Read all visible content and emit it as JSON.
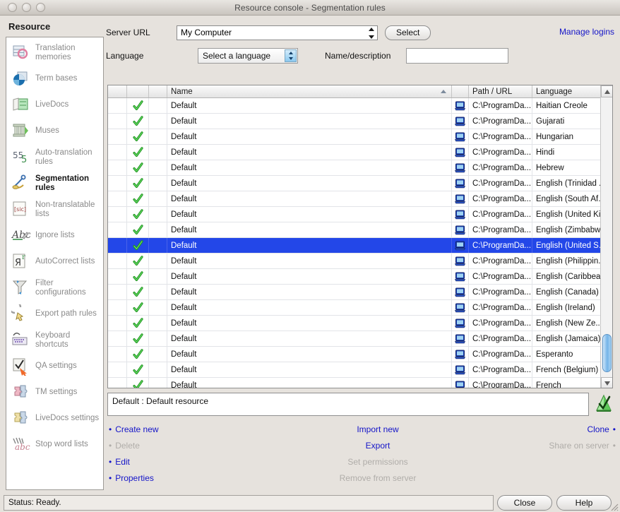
{
  "window": {
    "title": "Resource console - Segmentation rules",
    "traffic_buttons": [
      "close-button",
      "minimize-button",
      "zoom-button"
    ]
  },
  "sidebar": {
    "heading": "Resource",
    "items": [
      {
        "label": "Translation memories",
        "icon": "translation-memories-icon",
        "active": false
      },
      {
        "label": "Term bases",
        "icon": "term-bases-icon",
        "active": false
      },
      {
        "label": "LiveDocs",
        "icon": "livedocs-icon",
        "active": false
      },
      {
        "label": "Muses",
        "icon": "muses-icon",
        "active": false
      },
      {
        "label": "Auto-translation rules",
        "icon": "auto-translation-rules-icon",
        "active": false
      },
      {
        "label": "Segmentation rules",
        "icon": "segmentation-rules-icon",
        "active": true
      },
      {
        "label": "Non-translatable lists",
        "icon": "non-translatable-lists-icon",
        "active": false
      },
      {
        "label": "Ignore lists",
        "icon": "ignore-lists-icon",
        "active": false
      },
      {
        "label": "AutoCorrect lists",
        "icon": "autocorrect-lists-icon",
        "active": false
      },
      {
        "label": "Filter configurations",
        "icon": "filter-configurations-icon",
        "active": false
      },
      {
        "label": "Export path rules",
        "icon": "export-path-rules-icon",
        "active": false
      },
      {
        "label": "Keyboard shortcuts",
        "icon": "keyboard-shortcuts-icon",
        "active": false
      },
      {
        "label": "QA settings",
        "icon": "qa-settings-icon",
        "active": false
      },
      {
        "label": "TM settings",
        "icon": "tm-settings-icon",
        "active": false
      },
      {
        "label": "LiveDocs settings",
        "icon": "livedocs-settings-icon",
        "active": false
      },
      {
        "label": "Stop word lists",
        "icon": "stop-word-lists-icon",
        "active": false
      }
    ]
  },
  "toolbar": {
    "server_url_label": "Server URL",
    "server_url_value": "My Computer",
    "select_button": "Select",
    "manage_logins": "Manage logins",
    "language_label": "Language",
    "language_value": "Select a language",
    "name_description_label": "Name/description",
    "name_description_value": "",
    "name_description_placeholder": ""
  },
  "table": {
    "columns": [
      {
        "key": "selector",
        "label": ""
      },
      {
        "key": "enabled",
        "label": ""
      },
      {
        "key": "lock",
        "label": ""
      },
      {
        "key": "name",
        "label": "Name",
        "sorted": "asc"
      },
      {
        "key": "source_icon",
        "label": ""
      },
      {
        "key": "path",
        "label": "Path / URL"
      },
      {
        "key": "language",
        "label": "Language"
      }
    ],
    "rows": [
      {
        "enabled": true,
        "name": "Default",
        "path": "C:\\ProgramDa...",
        "language": "Haitian Creole",
        "selected": false
      },
      {
        "enabled": true,
        "name": "Default",
        "path": "C:\\ProgramDa...",
        "language": "Gujarati",
        "selected": false
      },
      {
        "enabled": true,
        "name": "Default",
        "path": "C:\\ProgramDa...",
        "language": "Hungarian",
        "selected": false
      },
      {
        "enabled": true,
        "name": "Default",
        "path": "C:\\ProgramDa...",
        "language": "Hindi",
        "selected": false
      },
      {
        "enabled": true,
        "name": "Default",
        "path": "C:\\ProgramDa...",
        "language": "Hebrew",
        "selected": false
      },
      {
        "enabled": true,
        "name": "Default",
        "path": "C:\\ProgramDa...",
        "language": "English (Trinidad ...",
        "selected": false
      },
      {
        "enabled": true,
        "name": "Default",
        "path": "C:\\ProgramDa...",
        "language": "English (South Af...",
        "selected": false
      },
      {
        "enabled": true,
        "name": "Default",
        "path": "C:\\ProgramDa...",
        "language": "English (United Ki...",
        "selected": false
      },
      {
        "enabled": true,
        "name": "Default",
        "path": "C:\\ProgramDa...",
        "language": "English (Zimbabwe)",
        "selected": false
      },
      {
        "enabled": true,
        "name": "Default",
        "path": "C:\\ProgramDa...",
        "language": "English (United S...",
        "selected": true
      },
      {
        "enabled": true,
        "name": "Default",
        "path": "C:\\ProgramDa...",
        "language": "English (Philippin...",
        "selected": false
      },
      {
        "enabled": true,
        "name": "Default",
        "path": "C:\\ProgramDa...",
        "language": "English (Caribbean)",
        "selected": false
      },
      {
        "enabled": true,
        "name": "Default",
        "path": "C:\\ProgramDa...",
        "language": "English (Canada)",
        "selected": false
      },
      {
        "enabled": true,
        "name": "Default",
        "path": "C:\\ProgramDa...",
        "language": "English (Ireland)",
        "selected": false
      },
      {
        "enabled": true,
        "name": "Default",
        "path": "C:\\ProgramDa...",
        "language": "English (New Ze...",
        "selected": false
      },
      {
        "enabled": true,
        "name": "Default",
        "path": "C:\\ProgramDa...",
        "language": "English (Jamaica)",
        "selected": false
      },
      {
        "enabled": true,
        "name": "Default",
        "path": "C:\\ProgramDa...",
        "language": "Esperanto",
        "selected": false
      },
      {
        "enabled": true,
        "name": "Default",
        "path": "C:\\ProgramDa...",
        "language": "French (Belgium)",
        "selected": false
      },
      {
        "enabled": true,
        "name": "Default",
        "path": "C:\\ProgramDa...",
        "language": "French",
        "selected": false
      }
    ]
  },
  "description": {
    "text": "Default : Default resource",
    "icon": "qa-check-icon"
  },
  "actions": {
    "left": [
      {
        "label": "Create new",
        "enabled": true
      },
      {
        "label": "Delete",
        "enabled": false
      },
      {
        "label": "Edit",
        "enabled": true
      },
      {
        "label": "Properties",
        "enabled": true
      }
    ],
    "middle": [
      {
        "label": "Import new",
        "enabled": true
      },
      {
        "label": "Export",
        "enabled": true
      },
      {
        "label": "Set permissions",
        "enabled": false
      },
      {
        "label": "Remove from server",
        "enabled": false
      }
    ],
    "right": [
      {
        "label": "Clone",
        "enabled": true
      },
      {
        "label": "Share on server",
        "enabled": false
      }
    ]
  },
  "statusbar": {
    "status": "Status: Ready.",
    "close_button": "Close",
    "help_button": "Help"
  },
  "colors": {
    "selection_blue": "#2347e8",
    "link_blue": "#1414c8",
    "link_disabled": "#b0ada9",
    "check_green": "#21a021",
    "window_bg": "#e6e2dd"
  }
}
